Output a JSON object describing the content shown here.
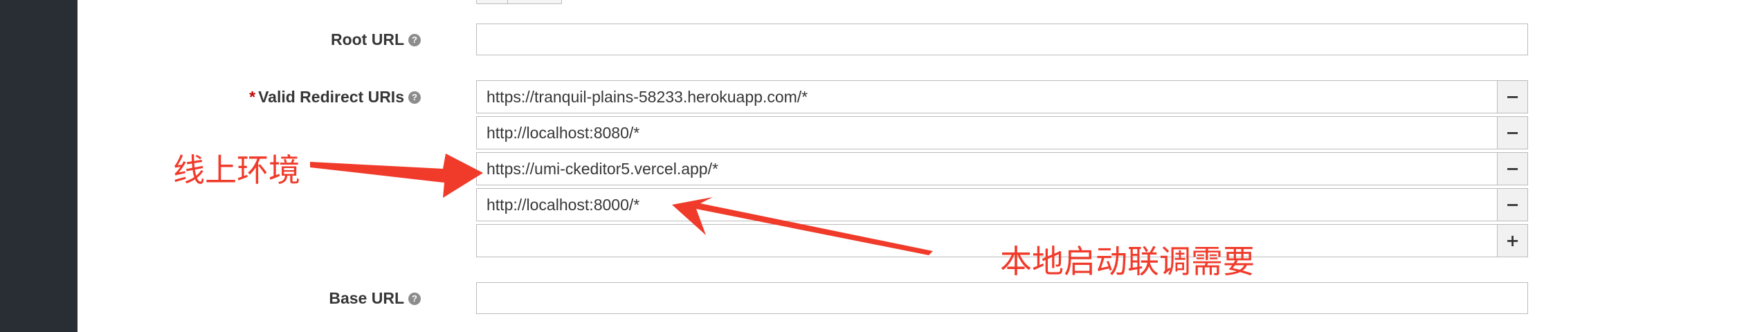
{
  "fields": {
    "root_url": {
      "label": "Root URL",
      "value": ""
    },
    "valid_redirect_uris": {
      "required_mark": "*",
      "label": "Valid Redirect URIs",
      "rows": [
        {
          "value": "https://tranquil-plains-58233.herokuapp.com/*",
          "button": "−"
        },
        {
          "value": "http://localhost:8080/*",
          "button": "−"
        },
        {
          "value": "https://umi-ckeditor5.vercel.app/*",
          "button": "−"
        },
        {
          "value": "http://localhost:8000/*",
          "button": "−"
        },
        {
          "value": "",
          "button": "+"
        }
      ]
    },
    "base_url": {
      "label": "Base URL",
      "value": ""
    }
  },
  "help_icon": {
    "name": "question-circle-icon",
    "glyph": "?"
  },
  "annotations": {
    "online_env": "线上环境",
    "local_debug": "本地启动联调需要",
    "color": "#f03a2a"
  },
  "colors": {
    "sidebar": "#292e34",
    "border": "#bbbbbb",
    "label": "#363636"
  }
}
